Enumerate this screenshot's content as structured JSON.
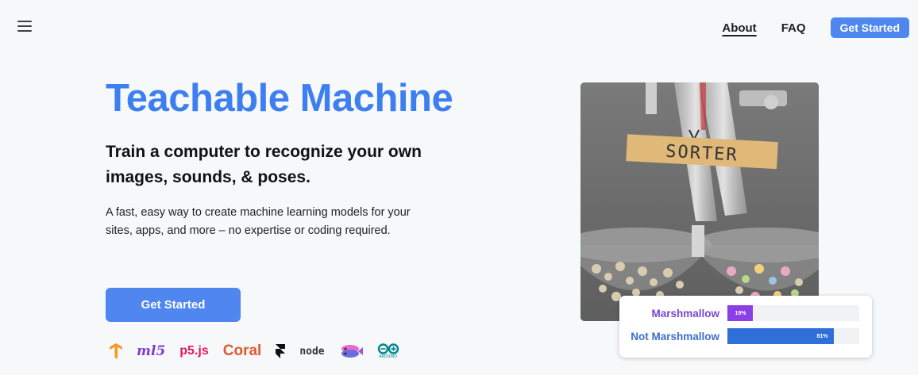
{
  "nav": {
    "menu_icon": "hamburger-menu-icon",
    "links": [
      {
        "label": "About",
        "active": true
      },
      {
        "label": "FAQ",
        "active": false
      }
    ],
    "cta_label": "Get Started"
  },
  "hero": {
    "title": "Teachable Machine",
    "subtitle": "Train a computer to recognize your own images, sounds, & poses.",
    "description": "A fast, easy way to create machine learning models for your sites, apps, and more – no expertise or coding required.",
    "cta_label": "Get Started"
  },
  "logos": {
    "tensorflow_icon": "tensorflow-logo",
    "ml5": "ml5",
    "p5": "p5.js",
    "coral": "Coral",
    "framer_icon": "framer-logo",
    "node": "node",
    "glitch_icon": "glitch-fish-logo",
    "arduino_label": "ARDUINO"
  },
  "sorter_image": {
    "label_text": "SORTER"
  },
  "predictions": [
    {
      "label": "Marshmallow",
      "value": 19,
      "value_text": "19%",
      "color": "#8b3fe6",
      "label_color": "#7b45d4"
    },
    {
      "label": "Not Marshmallow",
      "value": 81,
      "value_text": "81%",
      "color": "#2f6fd9",
      "label_color": "#3b6fcf"
    }
  ],
  "colors": {
    "accent": "#3d7ff0",
    "button": "#4f86f0",
    "background": "#f7f8fa"
  }
}
